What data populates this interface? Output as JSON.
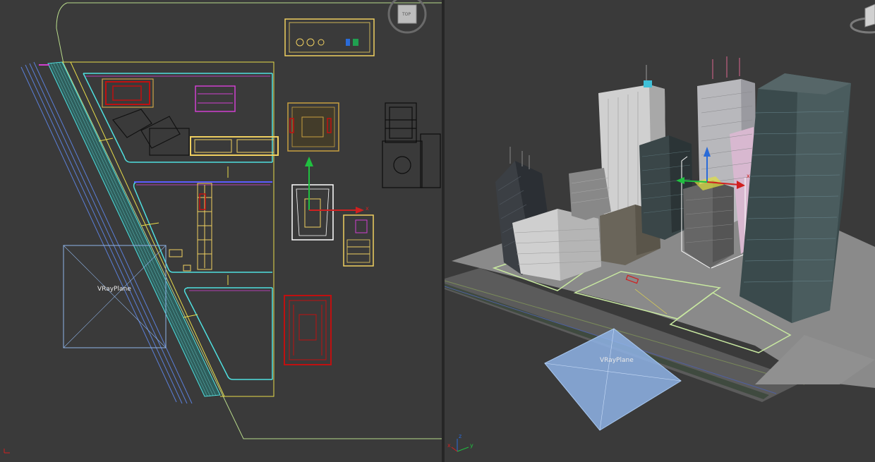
{
  "viewports": {
    "top": {
      "view_cube_label": "TOP",
      "plane_label": "VRayPlane"
    },
    "perspective": {
      "plane_label": "VRayPlane"
    }
  },
  "gizmo": {
    "x": "x",
    "y": "y",
    "z": "z"
  },
  "colors": {
    "background": "#3a3a3a",
    "road_cyan": "#4fe0e0",
    "selection_yellow": "#f0d060",
    "object_magenta": "#d040d0",
    "object_red": "#c01010",
    "vray_plane": "#8fb4e8"
  }
}
